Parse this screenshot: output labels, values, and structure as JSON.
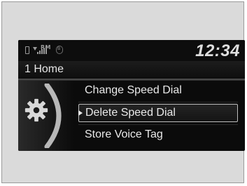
{
  "status": {
    "icons": [
      "phone-icon",
      "signal-icon",
      "bluetooth-icon"
    ],
    "rm_label": "RM",
    "clock": "12:34"
  },
  "header": {
    "title": "1 Home"
  },
  "menu": {
    "items": [
      {
        "label": "Change Speed Dial",
        "selected": false
      },
      {
        "label": "Delete Speed Dial",
        "selected": true
      },
      {
        "label": "Store Voice Tag",
        "selected": false
      }
    ]
  },
  "colors": {
    "screen_bg": "#0b0b0b",
    "text": "#e9e9e9",
    "selection_border": "#bdbdbd"
  }
}
